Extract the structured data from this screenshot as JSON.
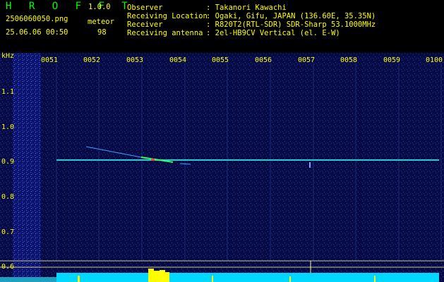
{
  "header": {
    "logo": "H R O F F T",
    "version": "1.0.0",
    "filename": "2506060050.png",
    "datetime": "25.06.06 00:50",
    "counter_label": "meteor",
    "counter_value": "98"
  },
  "station": {
    "observer_label": "Observer",
    "observer_value": ": Takanori Kawachi",
    "location_label": "Receiving Location",
    "location_value": ": Ogaki, Gifu, JAPAN (136.60E, 35.35N)",
    "receiver_label": "Receiver",
    "receiver_value": ": R820T2(RTL-SDR) SDR-Sharp 53.1000MHz",
    "antenna_label": "Receiving antenna",
    "antenna_value": ": 2el-HB9CV Vertical (el. E-W)"
  },
  "axes": {
    "y_unit": "kHz",
    "x_ticks": [
      "0051",
      "0052",
      "0053",
      "0054",
      "0055",
      "0056",
      "0057",
      "0058",
      "0059",
      "0100"
    ],
    "y_ticks": [
      "1.1",
      "1.0",
      "0.9",
      "0.8",
      "0.7",
      "0.6"
    ]
  },
  "colors": {
    "background": "#000000",
    "spectrum_bg": "#050a44",
    "text": "#ffff00",
    "logo": "#00ff00",
    "carrier": "#20d0d0",
    "meteor": "#ff4040",
    "power_bar": "#00d8ff",
    "burst": "#ffff00"
  }
}
